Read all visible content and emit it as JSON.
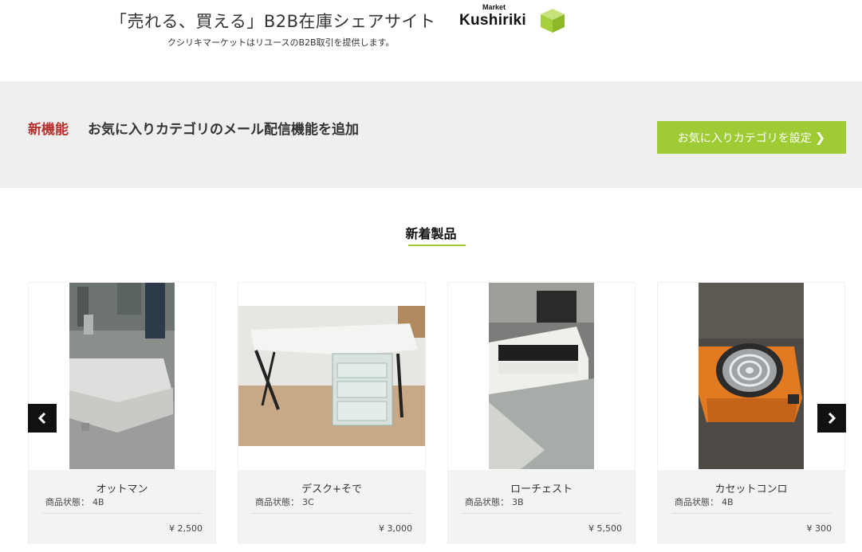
{
  "header": {
    "tagline": "「売れる、買える」B2B在庫シェアサイト",
    "subtagline": "クシリキマーケットはリユースのB2B取引を提供します。",
    "logo": {
      "small": "Market",
      "main": "Kushiriki",
      "cube_color": "#a6cf3c"
    }
  },
  "banner": {
    "tag": "新機能",
    "text": "お気に入りカテゴリのメール配信機能を追加",
    "button_label": "お気に入りカテゴリを設定",
    "button_color": "#9fcb35"
  },
  "section": {
    "title": "新着製品"
  },
  "carousel": {
    "prev_icon": "chevron-left-icon",
    "next_icon": "chevron-right-icon"
  },
  "products": [
    {
      "name": "オットマン",
      "condition_label": "商品状態：",
      "condition": "4B",
      "price": "¥ 2,500"
    },
    {
      "name": "デスク+そで",
      "condition_label": "商品状態：",
      "condition": "3C",
      "price": "¥ 3,000"
    },
    {
      "name": "ローチェスト",
      "condition_label": "商品状態：",
      "condition": "3B",
      "price": "¥ 5,500"
    },
    {
      "name": "カセットコンロ",
      "condition_label": "商品状態：",
      "condition": "4B",
      "price": "¥ 300"
    }
  ]
}
